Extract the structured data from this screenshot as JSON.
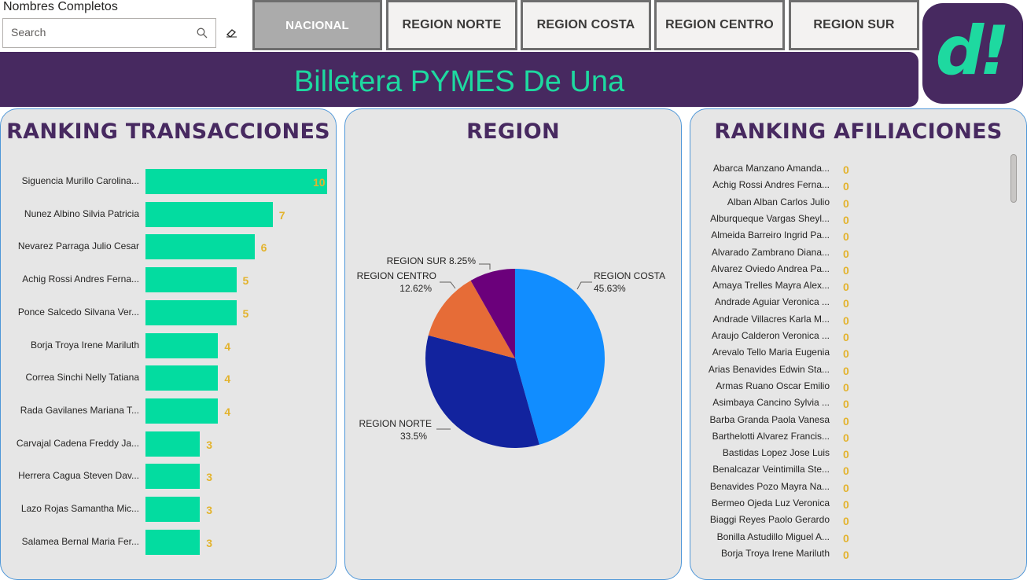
{
  "slicer": {
    "title": "Nombres Completos",
    "search_placeholder": "Search"
  },
  "region_buttons": [
    {
      "label": "NACIONAL",
      "active": true
    },
    {
      "label": "REGION NORTE",
      "active": false
    },
    {
      "label": "REGION COSTA",
      "active": false
    },
    {
      "label": "REGION CENTRO",
      "active": false
    },
    {
      "label": "REGION SUR",
      "active": false
    }
  ],
  "banner": {
    "title": "Billetera PYMES De Una"
  },
  "logo": {
    "text": "d!"
  },
  "colors": {
    "brand_purple": "#472960",
    "brand_green": "#1ed9a0",
    "bar_green": "#03dca0",
    "value_gold": "#e3b32d",
    "panel_border": "#4f97d8"
  },
  "panels": {
    "transacciones_title": "RANKING TRANSACCIONES",
    "region_title": "REGION",
    "afiliaciones_title": "RANKING AFILIACIONES"
  },
  "chart_data": [
    {
      "type": "bar",
      "orientation": "horizontal",
      "categories": [
        "Siguencia Murillo Carolina...",
        "Nunez Albino Silvia Patricia",
        "Nevarez Parraga Julio Cesar",
        "Achig Rossi Andres Ferna...",
        "Ponce Salcedo Silvana Ver...",
        "Borja Troya Irene Mariluth",
        "Correa Sinchi Nelly Tatiana",
        "Rada Gavilanes Mariana T...",
        "Carvajal Cadena Freddy Ja...",
        "Herrera Cagua Steven Dav...",
        "Lazo Rojas Samantha Mic...",
        "Salamea Bernal Maria Fer..."
      ],
      "values": [
        10,
        7,
        6,
        5,
        5,
        4,
        4,
        4,
        3,
        3,
        3,
        3
      ],
      "xlim": [
        0,
        10
      ]
    },
    {
      "type": "pie",
      "slices": [
        {
          "label": "REGION COSTA",
          "value": 45.63,
          "value_label": "45.63%",
          "color": "#118dff"
        },
        {
          "label": "REGION NORTE",
          "value": 33.5,
          "value_label": "33.5%",
          "color": "#12239e"
        },
        {
          "label": "REGION CENTRO",
          "value": 12.62,
          "value_label": "12.62%",
          "color": "#e66c37"
        },
        {
          "label": "REGION SUR",
          "value": 8.25,
          "value_label": "8.25%",
          "color": "#6b007b"
        }
      ]
    }
  ],
  "afiliaciones": [
    {
      "name": "Abarca Manzano Amanda...",
      "value": "0"
    },
    {
      "name": "Achig Rossi Andres Ferna...",
      "value": "0"
    },
    {
      "name": "Alban Alban Carlos Julio",
      "value": "0"
    },
    {
      "name": "Alburqueque Vargas Sheyl...",
      "value": "0"
    },
    {
      "name": "Almeida Barreiro Ingrid Pa...",
      "value": "0"
    },
    {
      "name": "Alvarado Zambrano Diana...",
      "value": "0"
    },
    {
      "name": "Alvarez Oviedo Andrea Pa...",
      "value": "0"
    },
    {
      "name": "Amaya Trelles Mayra Alex...",
      "value": "0"
    },
    {
      "name": "Andrade Aguiar Veronica ...",
      "value": "0"
    },
    {
      "name": "Andrade Villacres Karla M...",
      "value": "0"
    },
    {
      "name": "Araujo Calderon Veronica ...",
      "value": "0"
    },
    {
      "name": "Arevalo Tello Maria Eugenia",
      "value": "0"
    },
    {
      "name": "Arias Benavides Edwin Sta...",
      "value": "0"
    },
    {
      "name": "Armas Ruano Oscar Emilio",
      "value": "0"
    },
    {
      "name": "Asimbaya Cancino Sylvia ...",
      "value": "0"
    },
    {
      "name": "Barba Granda Paola Vanesa",
      "value": "0"
    },
    {
      "name": "Barthelotti Alvarez Francis...",
      "value": "0"
    },
    {
      "name": "Bastidas Lopez Jose Luis",
      "value": "0"
    },
    {
      "name": "Benalcazar Veintimilla Ste...",
      "value": "0"
    },
    {
      "name": "Benavides Pozo Mayra Na...",
      "value": "0"
    },
    {
      "name": "Bermeo Ojeda Luz Veronica",
      "value": "0"
    },
    {
      "name": "Biaggi Reyes Paolo Gerardo",
      "value": "0"
    },
    {
      "name": "Bonilla Astudillo Miguel A...",
      "value": "0"
    },
    {
      "name": "Borja Troya Irene Mariluth",
      "value": "0"
    }
  ]
}
